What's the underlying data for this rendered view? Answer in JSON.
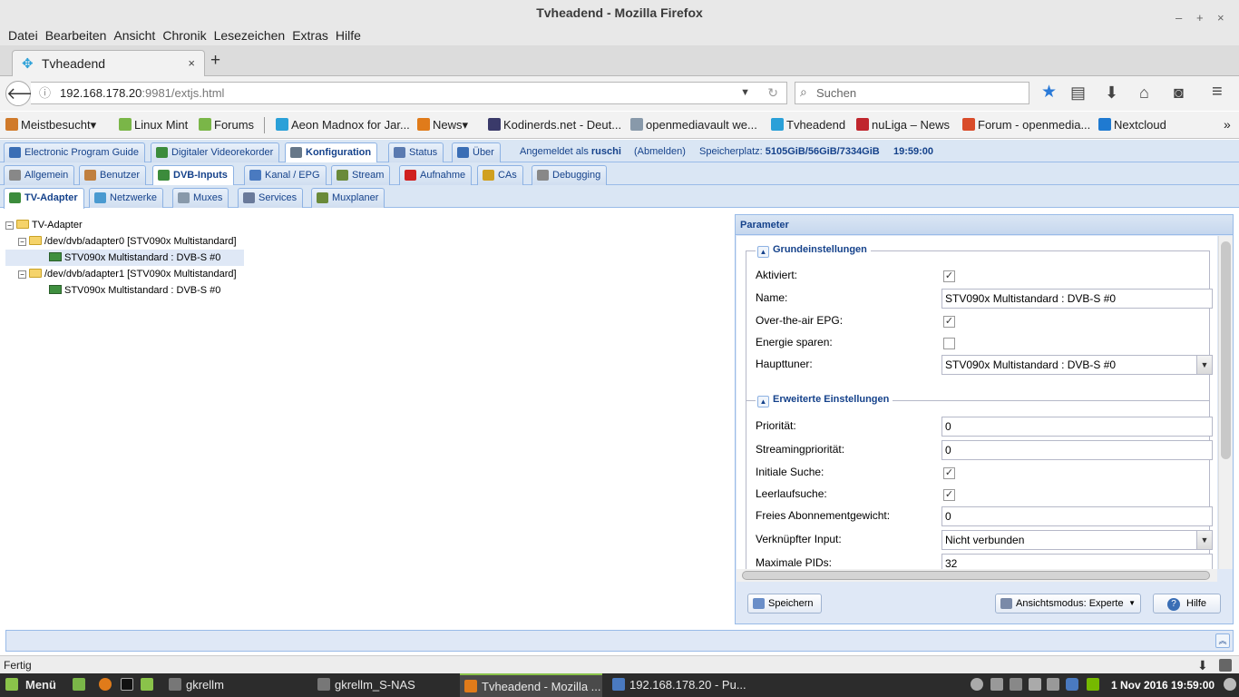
{
  "window": {
    "title": "Tvheadend - Mozilla Firefox",
    "minimize": "–",
    "maximize": "+",
    "close": "×"
  },
  "menu": [
    "Datei",
    "Bearbeiten",
    "Ansicht",
    "Chronik",
    "Lesezeichen",
    "Extras",
    "Hilfe"
  ],
  "browser_tab": {
    "title": "Tvheadend",
    "close": "×",
    "new_tab": "+"
  },
  "navbar": {
    "url_host": "192.168.178.20",
    "url_rest": ":9981/extjs.html",
    "search_placeholder": "Suchen"
  },
  "bookmarks": [
    {
      "label": "Meistbesucht▾",
      "color": "#d07a2a"
    },
    {
      "label": "Linux Mint",
      "color": "#7ab648"
    },
    {
      "label": "Forums",
      "color": "#7ab648"
    },
    {
      "label": "Aeon Madnox for Jar...",
      "color": "#2aa0d8"
    },
    {
      "label": "News▾",
      "color": "#e07b1a"
    },
    {
      "label": "Kodinerds.net - Deut...",
      "color": "#3a3a6a"
    },
    {
      "label": "openmediavault we...",
      "color": "#8899aa"
    },
    {
      "label": "Tvheadend",
      "color": "#2aa0d8"
    },
    {
      "label": "nuLiga – News",
      "color": "#c0262d"
    },
    {
      "label": "Forum - openmedia...",
      "color": "#d94c2a"
    },
    {
      "label": "Nextcloud",
      "color": "#1f7ad1"
    }
  ],
  "bookmarks_more": "»",
  "top_tabs": [
    {
      "label": "Electronic Program Guide",
      "active": false,
      "color": "#3a6eb5"
    },
    {
      "label": "Digitaler Videorekorder",
      "active": false,
      "color": "#3c8c3c"
    },
    {
      "label": "Konfiguration",
      "active": true,
      "color": "#667788"
    },
    {
      "label": "Status",
      "active": false,
      "color": "#5a7ab0"
    },
    {
      "label": "Über",
      "active": false,
      "color": "#3a6eb5"
    }
  ],
  "header_info": {
    "logged_in_prefix": "Angemeldet als",
    "user": "ruschi",
    "logout": "(Abmelden)",
    "storage_label": "Speicherplatz:",
    "storage_value": "5105GiB/56GiB/7334GiB",
    "time": "19:59:00"
  },
  "second_tabs": [
    {
      "label": "Allgemein",
      "active": false,
      "color": "#888"
    },
    {
      "label": "Benutzer",
      "active": false,
      "color": "#c08040"
    },
    {
      "label": "DVB-Inputs",
      "active": true,
      "color": "#3c8c3c"
    },
    {
      "label": "Kanal / EPG",
      "active": false,
      "color": "#4a7ac0"
    },
    {
      "label": "Stream",
      "active": false,
      "color": "#6a8a3a"
    },
    {
      "label": "Aufnahme",
      "active": false,
      "color": "#d02020"
    },
    {
      "label": "CAs",
      "active": false,
      "color": "#d0a020"
    },
    {
      "label": "Debugging",
      "active": false,
      "color": "#888"
    }
  ],
  "third_tabs": [
    {
      "label": "TV-Adapter",
      "active": true,
      "color": "#3c8c3c"
    },
    {
      "label": "Netzwerke",
      "active": false,
      "color": "#4a9ad0"
    },
    {
      "label": "Muxes",
      "active": false,
      "color": "#8899aa"
    },
    {
      "label": "Services",
      "active": false,
      "color": "#6a7a9a"
    },
    {
      "label": "Muxplaner",
      "active": false,
      "color": "#6a8a3a"
    }
  ],
  "tree": [
    {
      "label": "TV-Adapter",
      "level": 0,
      "type": "folder",
      "toggle": "−",
      "selected": false
    },
    {
      "label": "/dev/dvb/adapter0 [STV090x Multistandard]",
      "level": 1,
      "type": "folder",
      "toggle": "−",
      "selected": false
    },
    {
      "label": "STV090x Multistandard : DVB-S #0",
      "level": 2,
      "type": "card",
      "toggle": "",
      "selected": true
    },
    {
      "label": "/dev/dvb/adapter1 [STV090x Multistandard]",
      "level": 1,
      "type": "folder",
      "toggle": "−",
      "selected": false
    },
    {
      "label": "STV090x Multistandard : DVB-S #0",
      "level": 2,
      "type": "card",
      "toggle": "",
      "selected": false
    }
  ],
  "panel": {
    "title": "Parameter",
    "group1_title": "Grundeinstellungen",
    "group2_title": "Erweiterte Einstellungen",
    "fields1": [
      {
        "label": "Aktiviert:",
        "type": "check",
        "checked": true
      },
      {
        "label": "Name:",
        "type": "text",
        "value": "STV090x Multistandard : DVB-S #0"
      },
      {
        "label": "Over-the-air EPG:",
        "type": "check",
        "checked": true
      },
      {
        "label": "Energie sparen:",
        "type": "check",
        "checked": false
      },
      {
        "label": "Haupttuner:",
        "type": "combo",
        "value": "STV090x Multistandard : DVB-S #0"
      }
    ],
    "fields2": [
      {
        "label": "Priorität:",
        "type": "text",
        "value": "0"
      },
      {
        "label": "Streamingpriorität:",
        "type": "text",
        "value": "0"
      },
      {
        "label": "Initiale Suche:",
        "type": "check",
        "checked": true
      },
      {
        "label": "Leerlaufsuche:",
        "type": "check",
        "checked": true
      },
      {
        "label": "Freies Abonnementgewicht:",
        "type": "text",
        "value": "0"
      },
      {
        "label": "Verknüpfter Input:",
        "type": "combo",
        "value": "Nicht verbunden"
      },
      {
        "label": "Maximale PIDs:",
        "type": "text",
        "value": "32"
      }
    ],
    "save_button": "Speichern",
    "view_mode_button": "Ansichtsmodus: Experte",
    "help_button": "Hilfe"
  },
  "status_collapse": "︽",
  "firefox_status": "Fertig",
  "taskbar": {
    "menu_label": "Menü",
    "tasks": [
      {
        "label": "gkrellm",
        "active": false
      },
      {
        "label": "gkrellm_S-NAS",
        "active": false
      },
      {
        "label": "Tvheadend - Mozilla ...",
        "active": true
      },
      {
        "label": "192.168.178.20 - Pu...",
        "active": false
      }
    ],
    "clock": "1 Nov 2016 19:59:00"
  },
  "colors": {
    "ext_blue": "#15428b",
    "ext_border": "#99bbe8",
    "mint_green": "#8ac34a"
  }
}
